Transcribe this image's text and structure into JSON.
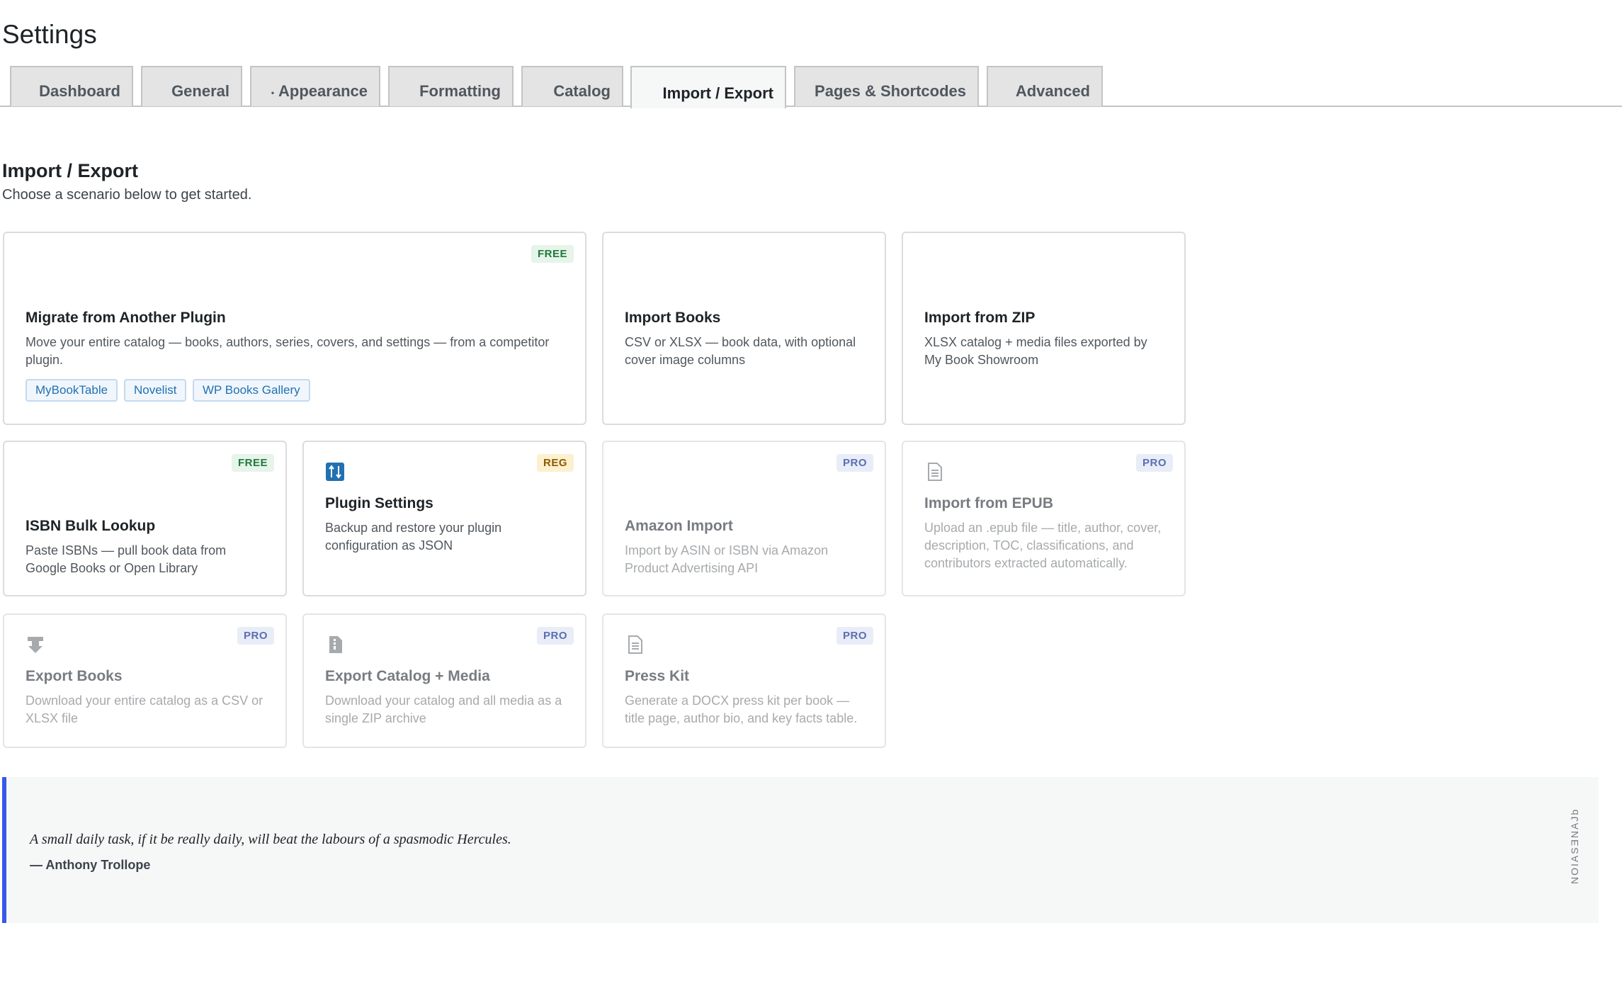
{
  "page": {
    "title": "Settings"
  },
  "tabs": [
    {
      "label": "Dashboard"
    },
    {
      "label": "General"
    },
    {
      "label": "Appearance"
    },
    {
      "label": "Formatting"
    },
    {
      "label": "Catalog"
    },
    {
      "label": "Import / Export",
      "active": true
    },
    {
      "label": "Pages & Shortcodes"
    },
    {
      "label": "Advanced"
    }
  ],
  "section": {
    "title": "Import / Export",
    "subtitle": "Choose a scenario below to get started."
  },
  "cards": {
    "migrate": {
      "badge": "FREE",
      "title": "Migrate from Another Plugin",
      "desc": "Move your entire catalog — books, authors, series, covers, and settings — from a competitor plugin.",
      "tags": [
        "MyBookTable",
        "Novelist",
        "WP Books Gallery"
      ]
    },
    "import_books": {
      "title": "Import Books",
      "desc": "CSV or XLSX — book data, with optional cover image columns"
    },
    "import_zip": {
      "title": "Import from ZIP",
      "desc": "XLSX catalog + media files exported by My Book Showroom"
    },
    "isbn": {
      "badge": "FREE",
      "title": "ISBN Bulk Lookup",
      "desc": "Paste ISBNs — pull book data from Google Books or Open Library"
    },
    "plugin_settings": {
      "badge": "REG",
      "icon": "settings-sliders-icon",
      "title": "Plugin Settings",
      "desc": "Backup and restore your plugin configuration as JSON"
    },
    "amazon": {
      "badge": "PRO",
      "title": "Amazon Import",
      "desc": "Import by ASIN or ISBN via Amazon Product Advertising API"
    },
    "epub": {
      "badge": "PRO",
      "icon": "document-icon",
      "title": "Import from EPUB",
      "desc": "Upload an .epub file — title, author, cover, description, TOC, classifications, and contributors extracted automatically."
    },
    "export_books": {
      "badge": "PRO",
      "icon": "download-icon",
      "title": "Export Books",
      "desc": "Download your entire catalog as a CSV or XLSX file"
    },
    "export_catalog": {
      "badge": "PRO",
      "icon": "archive-icon",
      "title": "Export Catalog + Media",
      "desc": "Download your catalog and all media as a single ZIP archive"
    },
    "press_kit": {
      "badge": "PRO",
      "icon": "document-icon",
      "title": "Press Kit",
      "desc": "Generate a DOCX press kit per book — title page, author bio, and key facts table."
    }
  },
  "quote": {
    "text": "A small daily task, if it be really daily, will beat the labours of a spasmodic Hercules.",
    "author": "— Anthony Trollope",
    "vertical_label": "NOIASƎNAJb"
  },
  "colors": {
    "accent": "#3858e9",
    "brand_blue": "#2271b1",
    "free": "#1f7a3a",
    "reg": "#8a5a00",
    "pro": "#5a6fb0"
  }
}
